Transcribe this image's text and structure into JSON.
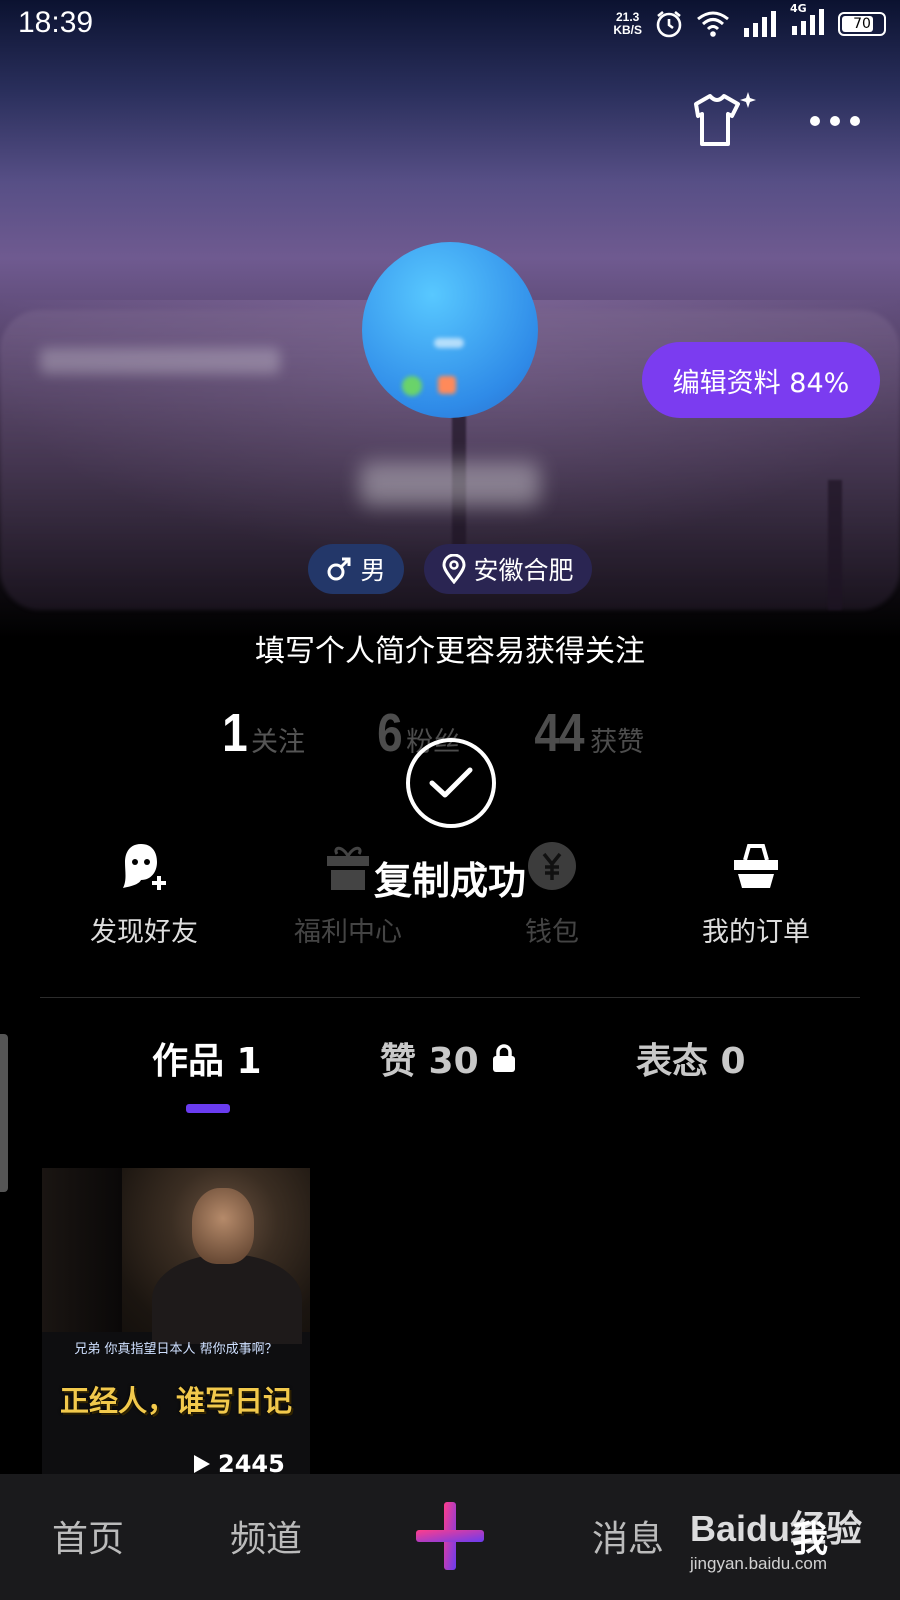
{
  "status_bar": {
    "time": "18:39",
    "net_speed_value": "21.3",
    "net_speed_unit": "KB/S",
    "signal_label": "4G",
    "battery": "70"
  },
  "profile": {
    "edit_button": "编辑资料 84%",
    "gender": "男",
    "location": "安徽合肥",
    "bio_prompt": "填写个人简介更容易获得关注"
  },
  "stats": [
    {
      "num": "1",
      "label": "关注"
    },
    {
      "num": "6",
      "label": "粉丝"
    },
    {
      "num": "44",
      "label": "获赞"
    }
  ],
  "quick_actions": [
    {
      "label": "发现好友",
      "icon": "add-friend-icon"
    },
    {
      "label": "福利中心",
      "icon": "gift-icon"
    },
    {
      "label": "钱包",
      "icon": "yuan-coin-icon"
    },
    {
      "label": "我的订单",
      "icon": "basket-icon"
    }
  ],
  "toast": "复制成功",
  "tabs": [
    {
      "label": "作品 1",
      "active": true
    },
    {
      "label": "赞 30",
      "locked": true
    },
    {
      "label": "表态 0"
    }
  ],
  "work": {
    "subtitle": "兄弟  你真指望日本人  帮你成事啊？",
    "title": "正经人，谁写日记",
    "plays": "2445"
  },
  "bottom_nav": [
    {
      "label": "首页"
    },
    {
      "label": "频道"
    },
    {
      "label": "消息"
    },
    {
      "label": "我",
      "active": true
    }
  ],
  "watermark": {
    "logo": "Baidu经验",
    "url": "jingyan.baidu.com"
  },
  "colors": {
    "accent_purple": "#7b3cf0",
    "gender_tag": "#233769",
    "location_tag": "#2a2552"
  }
}
